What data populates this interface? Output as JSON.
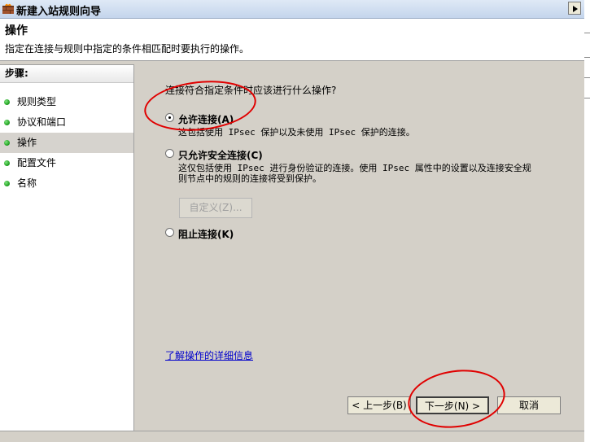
{
  "window": {
    "title": "新建入站规则向导"
  },
  "header": {
    "title": "操作",
    "description": "指定在连接与规则中指定的条件相匹配时要执行的操作。"
  },
  "sidebar": {
    "heading": "步骤:",
    "items": [
      {
        "label": "规则类型"
      },
      {
        "label": "协议和端口"
      },
      {
        "label": "操作"
      },
      {
        "label": "配置文件"
      },
      {
        "label": "名称"
      }
    ],
    "active_index": 2
  },
  "main": {
    "question": "连接符合指定条件时应该进行什么操作?",
    "options": [
      {
        "label": "允许连接(A)",
        "description": "这包括使用 IPsec 保护以及未使用 IPsec 保护的连接。",
        "checked": true
      },
      {
        "label": "只允许安全连接(C)",
        "description": "这仅包括使用 IPsec 进行身份验证的连接。使用 IPsec 属性中的设置以及连接安全规则节点中的规则的连接将受到保护。",
        "checked": false
      },
      {
        "label": "阻止连接(K)",
        "description": "",
        "checked": false
      }
    ],
    "customize_label": "自定义(Z)...",
    "learn_more_link": "了解操作的详细信息"
  },
  "footer": {
    "back_label": "< 上一步(B)",
    "next_label": "下一步(N) >",
    "cancel_label": "取消"
  },
  "colors": {
    "annotation": "#e00000",
    "link": "#0000cc",
    "step_bullet": "#1a9a1a"
  }
}
